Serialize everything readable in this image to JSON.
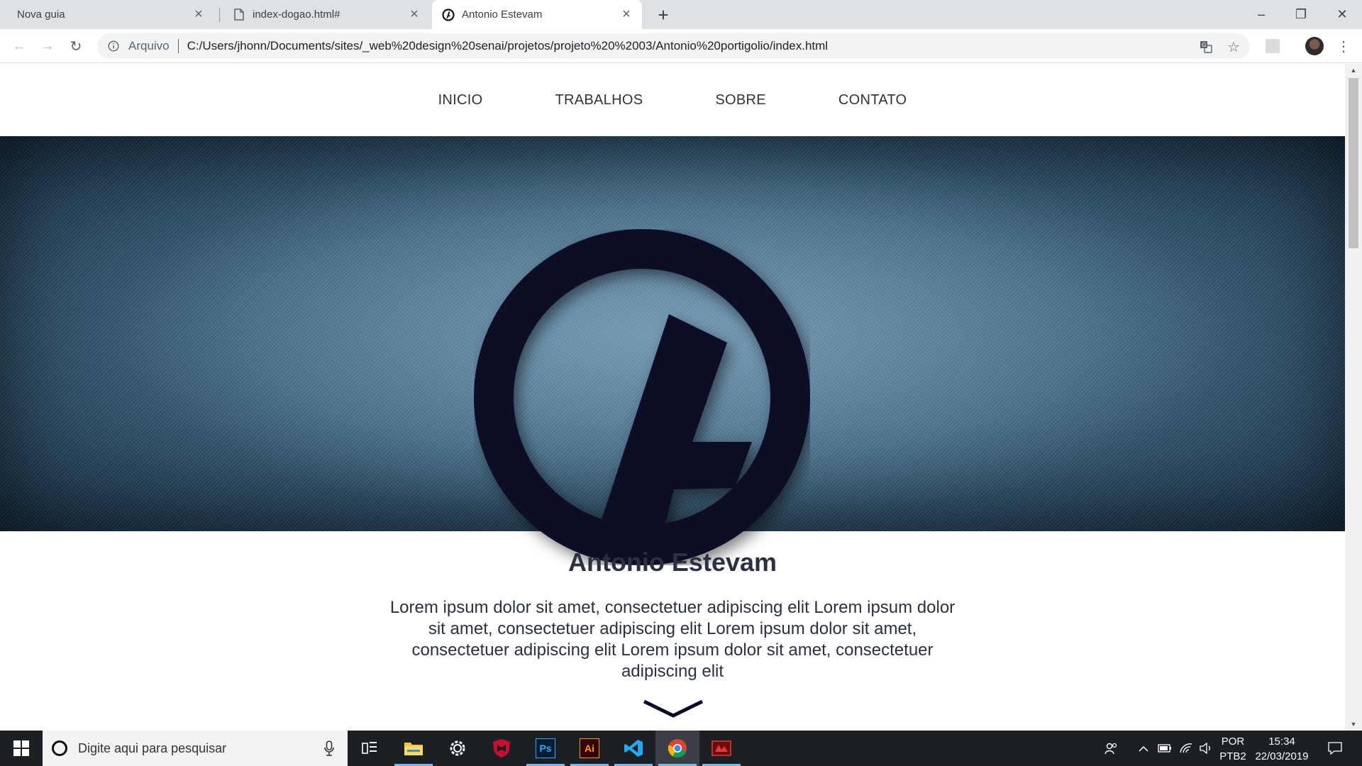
{
  "browser": {
    "tabs": [
      {
        "title": "Nova guia",
        "icon": "none",
        "active": false
      },
      {
        "title": "index-dogao.html#",
        "icon": "file-icon",
        "active": false
      },
      {
        "title": "Antonio Estevam",
        "icon": "site-logo-icon",
        "active": true
      }
    ],
    "new_tab_label": "+",
    "window_controls": {
      "minimize": "–",
      "restore": "❐",
      "close": "✕"
    },
    "toolbar": {
      "back": "←",
      "forward": "→",
      "reload": "↻",
      "scheme_label": "Arquivo",
      "url": "C:/Users/jhonn/Documents/sites/_web%20design%20senai/projetos/projeto%20%2003/Antonio%20portigolio/index.html",
      "bookmark_star": "☆",
      "menu": "⋮"
    }
  },
  "site": {
    "nav": [
      "INICIO",
      "TRABALHOS",
      "SOBRE",
      "CONTATO"
    ],
    "hero": {
      "logo_color": "#070b27"
    },
    "title": "Antonio Estevam",
    "text": "Lorem ipsum dolor sit amet, consectetuer adipiscing elit Lorem ipsum dolor sit amet, consectetuer adipiscing elit Lorem ipsum dolor sit amet, consectetuer adipiscing elit Lorem ipsum dolor sit amet, consectetuer adipiscing elit"
  },
  "taskbar": {
    "search_placeholder": "Digite aqui para pesquisar",
    "apps": [
      {
        "name": "task-view",
        "label": ""
      },
      {
        "name": "file-explorer",
        "label": ""
      },
      {
        "name": "settings",
        "label": ""
      },
      {
        "name": "mcafee",
        "label": ""
      },
      {
        "name": "photoshop",
        "label": "Ps"
      },
      {
        "name": "illustrator",
        "label": "Ai"
      },
      {
        "name": "vscode",
        "label": ""
      },
      {
        "name": "chrome",
        "label": ""
      },
      {
        "name": "app-red",
        "label": ""
      }
    ],
    "language": {
      "line1": "POR",
      "line2": "PTB2"
    },
    "clock": {
      "time": "15:34",
      "date": "22/03/2019"
    }
  }
}
